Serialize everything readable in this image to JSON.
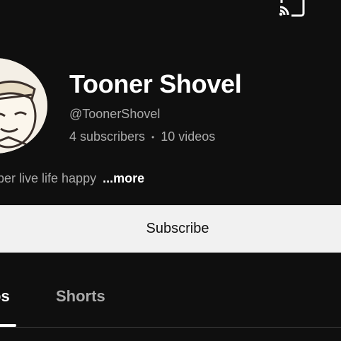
{
  "header": {
    "cast_icon": "cast-icon"
  },
  "channel": {
    "name": "Tooner Shovel",
    "handle": "@ToonerShovel",
    "subscribers": "4 subscribers",
    "separator": "•",
    "videos": "10 videos",
    "description": "ber live life happy",
    "more_label": "...more",
    "avatar_icon": "channel-avatar"
  },
  "actions": {
    "subscribe_label": "Subscribe"
  },
  "tabs": [
    {
      "label": "os",
      "selected": true
    },
    {
      "label": "Shorts",
      "selected": false
    }
  ],
  "colors": {
    "background": "#0f0f0f",
    "text_primary": "#ffffff",
    "text_secondary": "#aaaaaa",
    "subscribe_bg": "#f1f1f1"
  }
}
